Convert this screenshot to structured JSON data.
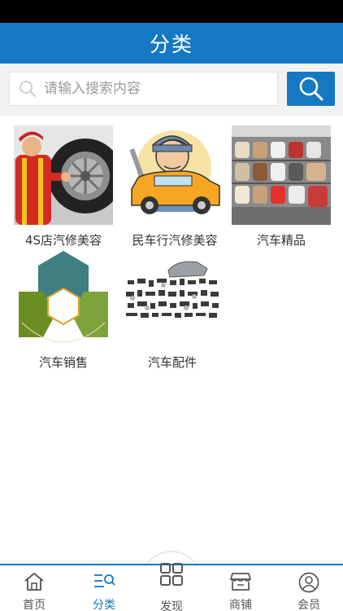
{
  "header": {
    "title": "分类"
  },
  "search": {
    "placeholder": "请输入搜索内容"
  },
  "categories": [
    {
      "label": "4S店汽修美容",
      "image": "mechanic-with-tire"
    },
    {
      "label": "民车行汽修美容",
      "image": "cartoon-mechanic-on-car"
    },
    {
      "label": "汽车精品",
      "image": "car-seat-covers-shelf"
    },
    {
      "label": "汽车销售",
      "image": "hexagon-marketing-diagram"
    },
    {
      "label": "汽车配件",
      "image": "car-parts-layout"
    }
  ],
  "tabs": [
    {
      "label": "首页",
      "icon": "home-icon"
    },
    {
      "label": "分类",
      "icon": "category-icon"
    },
    {
      "label": "发现",
      "icon": "grid-icon"
    },
    {
      "label": "商铺",
      "icon": "shop-icon"
    },
    {
      "label": "会员",
      "icon": "user-icon"
    }
  ],
  "colors": {
    "primary": "#1578c2"
  }
}
